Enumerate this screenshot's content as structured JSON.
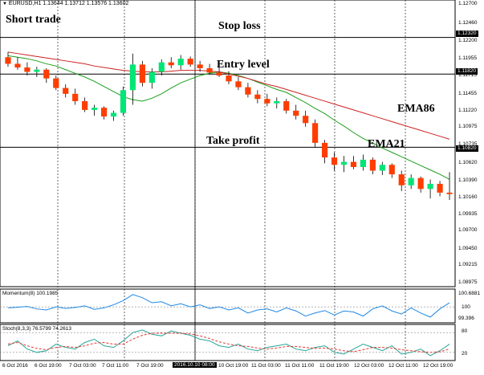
{
  "header": {
    "symbol_info": "EURUSD,H1  1.13644 1.13712 1.13576 1.13602",
    "arrow_icon": "triangle-down-icon"
  },
  "annotations": {
    "short_trade": "Short trade",
    "stop_loss": "Stop loss",
    "entry_level": "Entry level",
    "take_profit": "Take profit",
    "ema86": "EMA86",
    "ema21": "EMA21"
  },
  "level_labels": {
    "stop_loss": "1.12320",
    "entry": "1.11820",
    "take_profit": "1.10820"
  },
  "price_ticks": [
    "1.12700",
    "1.12460",
    "1.12200",
    "1.11955",
    "1.11715",
    "1.11455",
    "1.11220",
    "1.10975",
    "1.10735",
    "1.10620",
    "1.10390",
    "1.10160",
    "1.09935",
    "1.09700",
    "1.09450",
    "1.09215",
    "1.08975"
  ],
  "time_ticks": [
    "6 Oct 2016",
    "6 Oct 19:00",
    "7 Oct 03:00",
    "7 Oct 11:00",
    "7 Oct 19:00",
    "2016.10.10 08:00",
    "10 Oct 19:00",
    "11 Oct 03:00",
    "11 Oct 11:00",
    "11 Oct 19:00",
    "12 Oct 03:00",
    "12 Oct 11:00",
    "12 Oct 19:00"
  ],
  "highlighted_time": "2016.10.10 08:00",
  "momentum": {
    "label": "Momentum(8) 100.1985",
    "ticks": [
      "100.6881",
      "100",
      "99.396"
    ]
  },
  "stochastic": {
    "label": "Stoch(8,3,3) 76.5799 74.2613",
    "ticks": [
      "80",
      "20"
    ]
  },
  "colors": {
    "bull": "#00e676",
    "bear": "#ff3d00",
    "ema21": "#1b9e1b",
    "ema86": "#cc2222",
    "momentum": "#1e88e5",
    "stoch_main": "#26a69a",
    "stoch_signal": "#e53935"
  },
  "chart_data": {
    "type": "candlestick",
    "series": [
      {
        "name": "EMA21",
        "values": [
          1.1207,
          1.1205,
          1.1203,
          1.12,
          1.1196,
          1.1193,
          1.1188,
          1.1183,
          1.1178,
          1.1172,
          1.1165,
          1.1158,
          1.1151,
          1.1147,
          1.1145,
          1.1149,
          1.1155,
          1.1163,
          1.117,
          1.1175,
          1.118,
          1.1183,
          1.1185,
          1.1183,
          1.118,
          1.1176,
          1.1171,
          1.1166,
          1.1161,
          1.1157,
          1.115,
          1.1143,
          1.1135,
          1.1128,
          1.1119,
          1.1111,
          1.1102,
          1.1094,
          1.1088,
          1.1081,
          1.1075,
          1.1069,
          1.1063,
          1.1057,
          1.1051,
          1.1045,
          1.1038
        ]
      },
      {
        "name": "EMA86",
        "values": [
          1.1212,
          1.121,
          1.1208,
          1.1206,
          1.1204,
          1.1202,
          1.12,
          1.1198,
          1.1196,
          1.1193,
          1.1191,
          1.1189,
          1.1187,
          1.1186,
          1.1185,
          1.1185,
          1.1185,
          1.1186,
          1.1187,
          1.1187,
          1.1187,
          1.1186,
          1.1185,
          1.1182,
          1.1179,
          1.1176,
          1.1172,
          1.1168,
          1.1165,
          1.1161,
          1.1157,
          1.1153,
          1.1149,
          1.1145,
          1.1141,
          1.1137,
          1.1133,
          1.1129,
          1.1125,
          1.1121,
          1.1117,
          1.1113,
          1.1109,
          1.1105,
          1.1101,
          1.1097,
          1.1093
        ]
      },
      {
        "name": "Momentum",
        "values": [
          99.95,
          99.98,
          100.02,
          99.9,
          99.85,
          100.0,
          99.92,
          99.97,
          100.05,
          99.88,
          99.95,
          100.1,
          100.3,
          100.6,
          100.45,
          100.2,
          100.25,
          100.05,
          100.15,
          100.0,
          100.1,
          99.92,
          100.0,
          99.85,
          99.95,
          99.7,
          99.85,
          99.9,
          99.75,
          99.95,
          99.8,
          99.55,
          99.7,
          99.82,
          99.6,
          99.8,
          99.75,
          99.55,
          99.9,
          100.05,
          99.8,
          99.65,
          99.95,
          99.7,
          99.5,
          99.9,
          100.2
        ]
      },
      {
        "name": "Stoch %K",
        "values": [
          40,
          55,
          30,
          20,
          25,
          45,
          35,
          30,
          50,
          60,
          40,
          35,
          55,
          80,
          88,
          75,
          70,
          85,
          78,
          72,
          60,
          55,
          40,
          35,
          45,
          30,
          25,
          35,
          40,
          45,
          30,
          25,
          35,
          40,
          20,
          15,
          30,
          45,
          35,
          25,
          40,
          15,
          20,
          30,
          10,
          25,
          45
        ]
      },
      {
        "name": "Stoch %D",
        "values": [
          45,
          50,
          40,
          32,
          28,
          35,
          38,
          35,
          40,
          48,
          50,
          45,
          45,
          60,
          72,
          78,
          78,
          78,
          78,
          76,
          70,
          62,
          52,
          45,
          40,
          38,
          33,
          30,
          33,
          38,
          38,
          35,
          32,
          33,
          30,
          25,
          22,
          28,
          35,
          35,
          33,
          28,
          25,
          22,
          20,
          22,
          30
        ]
      }
    ],
    "candles": [
      [
        1.1205,
        1.1212,
        1.1192,
        1.1196
      ],
      [
        1.1196,
        1.1205,
        1.1188,
        1.1191
      ],
      [
        1.1191,
        1.1198,
        1.118,
        1.1185
      ],
      [
        1.1185,
        1.1192,
        1.1178,
        1.1188
      ],
      [
        1.1188,
        1.119,
        1.117,
        1.1176
      ],
      [
        1.1176,
        1.118,
        1.116,
        1.1163
      ],
      [
        1.1163,
        1.1168,
        1.115,
        1.1155
      ],
      [
        1.1155,
        1.1162,
        1.114,
        1.1145
      ],
      [
        1.1145,
        1.115,
        1.113,
        1.1133
      ],
      [
        1.1133,
        1.114,
        1.1125,
        1.1136
      ],
      [
        1.1136,
        1.1138,
        1.112,
        1.1124
      ],
      [
        1.1124,
        1.1132,
        1.1118,
        1.1129
      ],
      [
        1.1129,
        1.1165,
        1.1125,
        1.116
      ],
      [
        1.116,
        1.121,
        1.114,
        1.1195
      ],
      [
        1.1195,
        1.12,
        1.1165,
        1.117
      ],
      [
        1.117,
        1.119,
        1.1162,
        1.1185
      ],
      [
        1.1185,
        1.1202,
        1.118,
        1.1198
      ],
      [
        1.1198,
        1.1205,
        1.119,
        1.1194
      ],
      [
        1.1194,
        1.1208,
        1.1188,
        1.1203
      ],
      [
        1.1203,
        1.1206,
        1.1192,
        1.1195
      ],
      [
        1.1195,
        1.12,
        1.1185,
        1.119
      ],
      [
        1.119,
        1.1196,
        1.1182,
        1.1184
      ],
      [
        1.1184,
        1.1192,
        1.1178,
        1.118
      ],
      [
        1.118,
        1.1186,
        1.1168,
        1.1172
      ],
      [
        1.1172,
        1.1178,
        1.116,
        1.1164
      ],
      [
        1.1164,
        1.117,
        1.115,
        1.1154
      ],
      [
        1.1154,
        1.116,
        1.1142,
        1.1148
      ],
      [
        1.1148,
        1.1155,
        1.1138,
        1.1142
      ],
      [
        1.1142,
        1.115,
        1.1135,
        1.1145
      ],
      [
        1.1145,
        1.1148,
        1.1128,
        1.1132
      ],
      [
        1.1132,
        1.114,
        1.112,
        1.1125
      ],
      [
        1.1125,
        1.1132,
        1.111,
        1.1115
      ],
      [
        1.1115,
        1.112,
        1.1082,
        1.1088
      ],
      [
        1.1088,
        1.1092,
        1.106,
        1.1068
      ],
      [
        1.1068,
        1.1075,
        1.105,
        1.1058
      ],
      [
        1.1058,
        1.107,
        1.1048,
        1.1062
      ],
      [
        1.1062,
        1.107,
        1.1052,
        1.1055
      ],
      [
        1.1055,
        1.1072,
        1.105,
        1.1065
      ],
      [
        1.1065,
        1.1068,
        1.1045,
        1.105
      ],
      [
        1.105,
        1.1062,
        1.1044,
        1.1058
      ],
      [
        1.1058,
        1.106,
        1.104,
        1.1045
      ],
      [
        1.1045,
        1.105,
        1.1022,
        1.103
      ],
      [
        1.103,
        1.1045,
        1.1025,
        1.104
      ],
      [
        1.104,
        1.1042,
        1.102,
        1.1025
      ],
      [
        1.1025,
        1.1038,
        1.1012,
        1.1032
      ],
      [
        1.1032,
        1.1036,
        1.1015,
        1.102
      ],
      [
        1.102,
        1.1048,
        1.101,
        1.1018
      ]
    ],
    "levels": {
      "stop_loss": 1.1232,
      "entry": 1.1182,
      "take_profit": 1.1082
    },
    "ylim": [
      1.0897,
      1.127
    ]
  }
}
